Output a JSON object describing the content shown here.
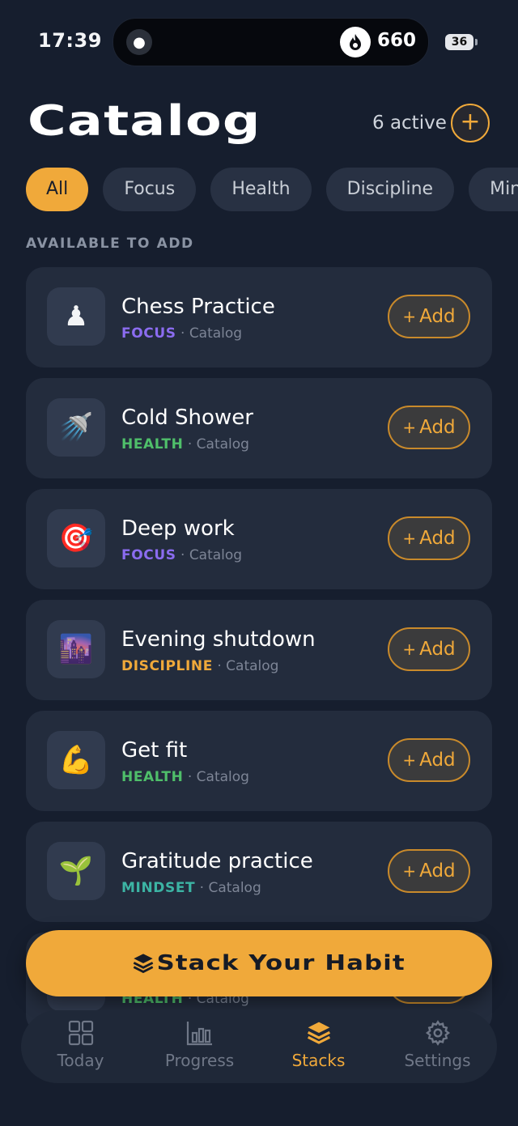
{
  "status": {
    "time": "17:39",
    "streak": "660",
    "battery": "36"
  },
  "header": {
    "title": "Catalog",
    "active_count": "6 active"
  },
  "filters": [
    "All",
    "Focus",
    "Health",
    "Discipline",
    "Minds"
  ],
  "section_label": "AVAILABLE TO ADD",
  "habits": [
    {
      "emoji": "♟",
      "name": "Chess Practice",
      "category": "FOCUS",
      "category_key": "focus",
      "source": "Catalog"
    },
    {
      "emoji": "🚿",
      "name": "Cold Shower",
      "category": "HEALTH",
      "category_key": "health",
      "source": "Catalog"
    },
    {
      "emoji": "🎯",
      "name": "Deep work",
      "category": "FOCUS",
      "category_key": "focus",
      "source": "Catalog"
    },
    {
      "emoji": "🌆",
      "name": "Evening shutdown",
      "category": "DISCIPLINE",
      "category_key": "discipline",
      "source": "Catalog"
    },
    {
      "emoji": "💪",
      "name": "Get fit",
      "category": "HEALTH",
      "category_key": "health",
      "source": "Catalog"
    },
    {
      "emoji": "🌱",
      "name": "Gratitude practice",
      "category": "MINDSET",
      "category_key": "mindset",
      "source": "Catalog"
    },
    {
      "emoji": "",
      "name": "",
      "category": "HEALTH",
      "category_key": "health",
      "source": "Catalog"
    }
  ],
  "add_label": "Add",
  "cta": {
    "label": "Stack Your Habit"
  },
  "tabs": [
    {
      "label": "Today",
      "icon": "grid-icon"
    },
    {
      "label": "Progress",
      "icon": "bar-chart-icon"
    },
    {
      "label": "Stacks",
      "icon": "layers-icon"
    },
    {
      "label": "Settings",
      "icon": "gear-icon"
    }
  ],
  "colors": {
    "accent": "#f0a93a",
    "background": "#161e2e",
    "card": "#232c3d",
    "focus": "#8b6cf0",
    "health": "#4fbf6a",
    "discipline": "#f0a93a",
    "mindset": "#3cb4a4"
  }
}
